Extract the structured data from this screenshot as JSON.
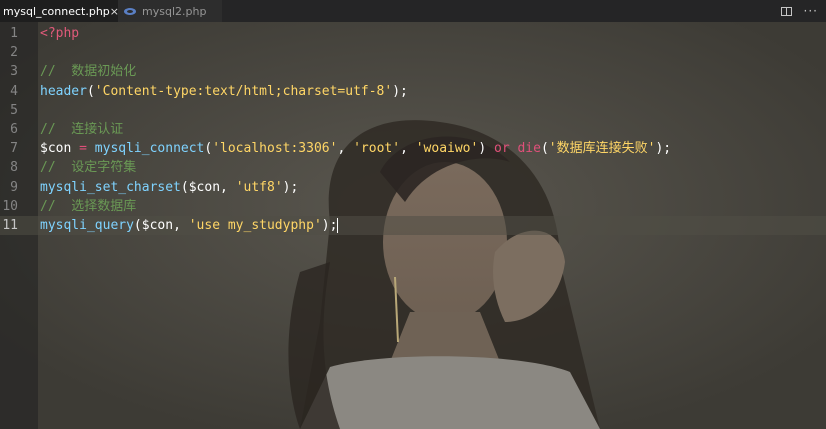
{
  "tabs": [
    {
      "label": "mysql_connect.php",
      "active": true,
      "close": "×"
    },
    {
      "label": "mysql2.php",
      "active": false
    }
  ],
  "actions": {
    "more": "···"
  },
  "editor": {
    "current_line": 11,
    "lines": [
      {
        "n": "1",
        "tokens": [
          [
            "t-tag",
            "<?php"
          ]
        ]
      },
      {
        "n": "2",
        "tokens": []
      },
      {
        "n": "3",
        "tokens": [
          [
            "t-cmt",
            "//  数据初始化"
          ]
        ]
      },
      {
        "n": "4",
        "tokens": [
          [
            "t-fn",
            "header"
          ],
          [
            "t-punc",
            "("
          ],
          [
            "t-str",
            "'Content-type:text/html;charset=utf-8'"
          ],
          [
            "t-punc",
            ");"
          ]
        ]
      },
      {
        "n": "5",
        "tokens": []
      },
      {
        "n": "6",
        "tokens": [
          [
            "t-cmt",
            "//  连接认证"
          ]
        ]
      },
      {
        "n": "7",
        "tokens": [
          [
            "t-var",
            "$con"
          ],
          [
            "t-punc",
            " "
          ],
          [
            "t-op",
            "="
          ],
          [
            "t-punc",
            " "
          ],
          [
            "t-fn",
            "mysqli_connect"
          ],
          [
            "t-punc",
            "("
          ],
          [
            "t-str",
            "'localhost:3306'"
          ],
          [
            "t-punc",
            ", "
          ],
          [
            "t-str",
            "'root'"
          ],
          [
            "t-punc",
            ", "
          ],
          [
            "t-str",
            "'woaiwo'"
          ],
          [
            "t-punc",
            ") "
          ],
          [
            "t-kw",
            "or"
          ],
          [
            "t-punc",
            " "
          ],
          [
            "t-kw",
            "die"
          ],
          [
            "t-punc",
            "("
          ],
          [
            "t-str",
            "'数据库连接失败'"
          ],
          [
            "t-punc",
            ");"
          ]
        ]
      },
      {
        "n": "8",
        "tokens": [
          [
            "t-cmt",
            "//  设定字符集"
          ]
        ]
      },
      {
        "n": "9",
        "tokens": [
          [
            "t-fn",
            "mysqli_set_charset"
          ],
          [
            "t-punc",
            "("
          ],
          [
            "t-var",
            "$con"
          ],
          [
            "t-punc",
            ", "
          ],
          [
            "t-str",
            "'utf8'"
          ],
          [
            "t-punc",
            ");"
          ]
        ]
      },
      {
        "n": "10",
        "tokens": [
          [
            "t-cmt",
            "//  选择数据库"
          ]
        ]
      },
      {
        "n": "11",
        "tokens": [
          [
            "t-fn",
            "mysqli_query"
          ],
          [
            "t-punc",
            "("
          ],
          [
            "t-var",
            "$con"
          ],
          [
            "t-punc",
            ", "
          ],
          [
            "t-str",
            "'use my_studyphp'"
          ],
          [
            "t-punc",
            ");"
          ]
        ]
      }
    ]
  }
}
